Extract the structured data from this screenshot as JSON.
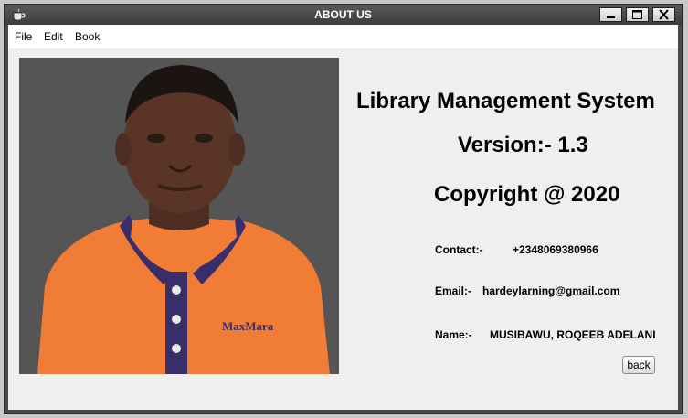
{
  "window": {
    "title": "ABOUT US"
  },
  "menu": {
    "items": [
      "File",
      "Edit",
      "Book"
    ]
  },
  "about": {
    "app_name": "Library Management System",
    "version": "Version:- 1.3",
    "copyright": "Copyright @ 2020",
    "contact_label": "Contact:-",
    "contact_value": "+2348069380966",
    "email_label": "Email:-",
    "email_value": "hardeylarning@gmail.com",
    "name_label": "Name:-",
    "name_value": "MUSIBAWU, ROQEEB ADELANI"
  },
  "photo": {
    "shirt_logo": "MaxMara"
  },
  "buttons": {
    "back": "back"
  },
  "colors": {
    "titlebar": "#4a4a4a",
    "client": "#efefef",
    "photo_bg": "#555555",
    "shirt": "#f07c35",
    "collar": "#3a2e6a"
  }
}
